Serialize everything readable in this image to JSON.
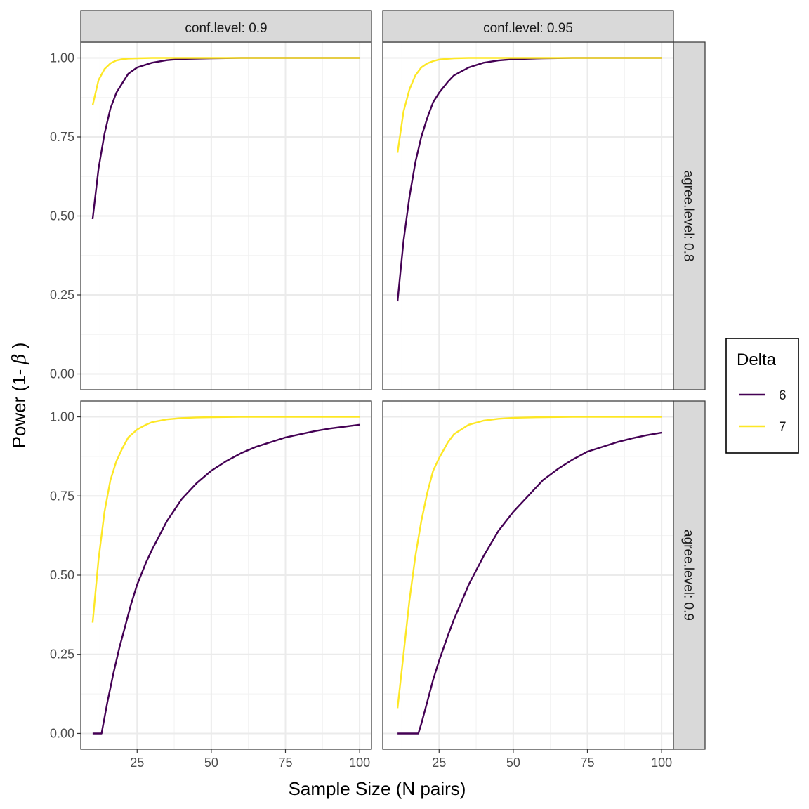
{
  "chart_data": {
    "type": "line",
    "xlabel": "Sample Size (N pairs)",
    "ylabel_prefix": "Power (1- ",
    "ylabel_symbol": "β",
    "ylabel_suffix": " )",
    "xlim": [
      6,
      104
    ],
    "ylim": [
      -0.05,
      1.05
    ],
    "xticks": [
      25,
      50,
      75,
      100
    ],
    "yticks": [
      0.0,
      0.25,
      0.5,
      0.75,
      1.0
    ],
    "ytick_labels": [
      "0.00",
      "0.25",
      "0.50",
      "0.75",
      "1.00"
    ],
    "grid": true,
    "column_strips": [
      "conf.level: 0.9",
      "conf.level: 0.95"
    ],
    "row_strips": [
      "agree.level: 0.8",
      "agree.level: 0.9"
    ],
    "legend": {
      "title": "Delta",
      "position": "right",
      "entries": [
        {
          "label": "6",
          "color": "#440154"
        },
        {
          "label": "7",
          "color": "#FDE725"
        }
      ]
    },
    "panels": [
      {
        "row": 0,
        "col": 0,
        "series": [
          {
            "name": "6",
            "x": [
              10,
              12,
              14,
              16,
              18,
              20,
              22,
              25,
              30,
              35,
              40,
              50,
              60,
              70,
              80,
              90,
              100
            ],
            "y": [
              0.49,
              0.65,
              0.76,
              0.84,
              0.89,
              0.92,
              0.95,
              0.97,
              0.985,
              0.993,
              0.997,
              0.999,
              1.0,
              1.0,
              1.0,
              1.0,
              1.0
            ]
          },
          {
            "name": "7",
            "x": [
              10,
              12,
              14,
              16,
              18,
              20,
              22,
              25,
              30,
              35,
              40,
              50,
              60,
              70,
              80,
              90,
              100
            ],
            "y": [
              0.85,
              0.93,
              0.965,
              0.983,
              0.992,
              0.996,
              0.998,
              0.999,
              1.0,
              1.0,
              1.0,
              1.0,
              1.0,
              1.0,
              1.0,
              1.0,
              1.0
            ]
          }
        ]
      },
      {
        "row": 0,
        "col": 1,
        "series": [
          {
            "name": "6",
            "x": [
              11,
              13,
              15,
              17,
              19,
              21,
              23,
              25,
              28,
              30,
              35,
              40,
              45,
              50,
              60,
              70,
              80,
              90,
              100
            ],
            "y": [
              0.23,
              0.42,
              0.56,
              0.67,
              0.75,
              0.81,
              0.86,
              0.89,
              0.925,
              0.945,
              0.97,
              0.985,
              0.992,
              0.996,
              0.999,
              1.0,
              1.0,
              1.0,
              1.0
            ]
          },
          {
            "name": "7",
            "x": [
              11,
              13,
              15,
              17,
              19,
              21,
              23,
              25,
              30,
              35,
              40,
              50,
              60,
              70,
              80,
              90,
              100
            ],
            "y": [
              0.7,
              0.83,
              0.9,
              0.945,
              0.97,
              0.983,
              0.99,
              0.995,
              0.999,
              1.0,
              1.0,
              1.0,
              1.0,
              1.0,
              1.0,
              1.0,
              1.0
            ]
          }
        ]
      },
      {
        "row": 1,
        "col": 0,
        "series": [
          {
            "name": "6",
            "x": [
              10,
              13,
              15,
              17,
              19,
              21,
              23,
              25,
              28,
              30,
              35,
              40,
              45,
              50,
              55,
              60,
              65,
              70,
              75,
              80,
              85,
              90,
              95,
              100
            ],
            "y": [
              0.0,
              0.0,
              0.1,
              0.19,
              0.27,
              0.34,
              0.41,
              0.47,
              0.54,
              0.58,
              0.67,
              0.74,
              0.79,
              0.83,
              0.86,
              0.885,
              0.905,
              0.92,
              0.935,
              0.945,
              0.955,
              0.963,
              0.969,
              0.975
            ]
          },
          {
            "name": "7",
            "x": [
              10,
              12,
              14,
              16,
              18,
              20,
              22,
              25,
              28,
              30,
              35,
              40,
              45,
              50,
              60,
              70,
              80,
              90,
              100
            ],
            "y": [
              0.35,
              0.55,
              0.7,
              0.8,
              0.86,
              0.9,
              0.935,
              0.96,
              0.975,
              0.983,
              0.992,
              0.996,
              0.998,
              0.999,
              1.0,
              1.0,
              1.0,
              1.0,
              1.0
            ]
          }
        ]
      },
      {
        "row": 1,
        "col": 1,
        "series": [
          {
            "name": "6",
            "x": [
              11,
              18,
              19,
              21,
              23,
              25,
              28,
              30,
              35,
              40,
              45,
              50,
              55,
              60,
              65,
              70,
              75,
              80,
              85,
              90,
              95,
              100
            ],
            "y": [
              0.0,
              0.0,
              0.03,
              0.1,
              0.17,
              0.23,
              0.31,
              0.36,
              0.47,
              0.56,
              0.64,
              0.7,
              0.75,
              0.8,
              0.835,
              0.865,
              0.89,
              0.905,
              0.92,
              0.932,
              0.942,
              0.95
            ]
          },
          {
            "name": "7",
            "x": [
              11,
              13,
              15,
              17,
              19,
              21,
              23,
              25,
              28,
              30,
              35,
              40,
              45,
              50,
              60,
              70,
              80,
              90,
              100
            ],
            "y": [
              0.08,
              0.25,
              0.42,
              0.56,
              0.67,
              0.76,
              0.83,
              0.87,
              0.92,
              0.945,
              0.975,
              0.988,
              0.994,
              0.997,
              0.999,
              1.0,
              1.0,
              1.0,
              1.0
            ]
          }
        ]
      }
    ]
  }
}
